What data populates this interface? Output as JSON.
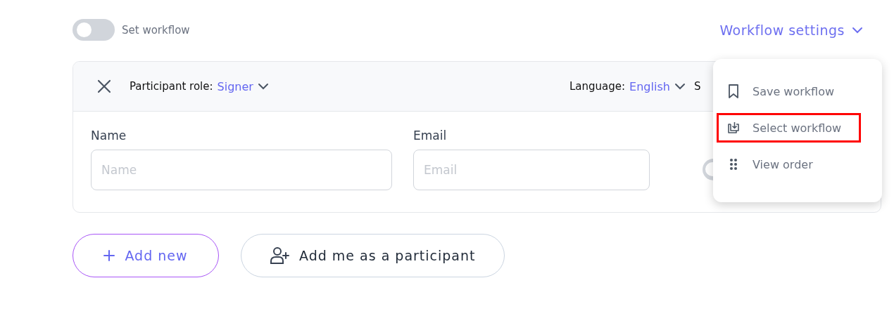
{
  "workflow_toggle": {
    "label": "Set workflow",
    "on": false
  },
  "workflow_settings": {
    "label": "Workflow settings",
    "expanded": true
  },
  "participant": {
    "role_label": "Participant role:",
    "role": "Signer",
    "language_label": "Language:",
    "language": "English",
    "column_3": "S",
    "fields": [
      {
        "label": "Name",
        "placeholder": "Name"
      },
      {
        "label": "Email",
        "placeholder": "Email"
      }
    ],
    "toggle": {
      "on": false
    }
  },
  "menu": [
    {
      "kind": "bookmark",
      "label": "Save workflow",
      "highlighted": false
    },
    {
      "kind": "import",
      "label": "Select workflow",
      "highlighted": true
    },
    {
      "kind": "dots",
      "label": "View order",
      "highlighted": false
    }
  ],
  "buttons": [
    {
      "kind": "add",
      "label": "Add new"
    },
    {
      "kind": "person",
      "label": "Add me as a participant"
    }
  ]
}
